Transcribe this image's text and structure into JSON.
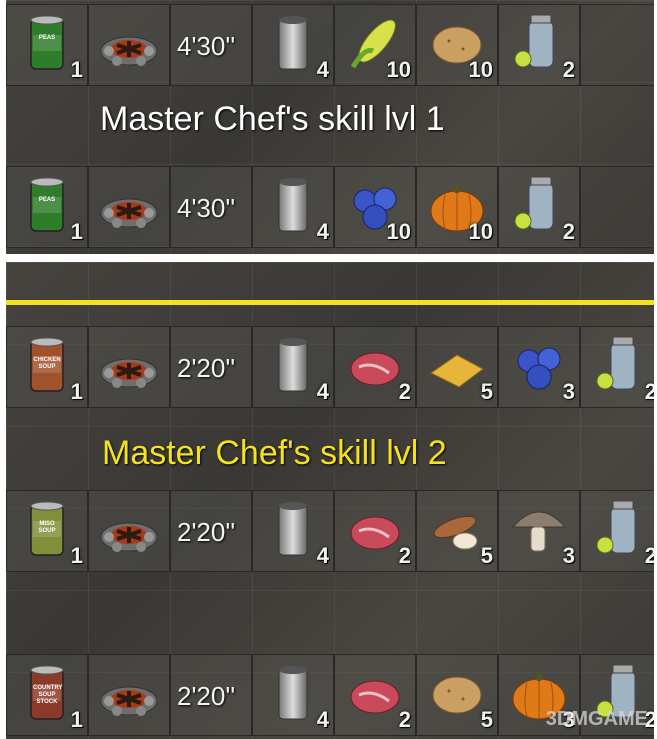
{
  "recipes_lvl1": [
    {
      "slots": [
        {
          "icon": "can-of-peas-icon",
          "qty": "1",
          "label": "PEAS"
        },
        {
          "icon": "campfire-icon"
        },
        {
          "time": "4'30''"
        },
        {
          "icon": "empty-can-icon",
          "qty": "4"
        },
        {
          "icon": "corn-icon",
          "qty": "10"
        },
        {
          "icon": "potato-icon",
          "qty": "10"
        },
        {
          "icon": "water-jar-icon",
          "qty": "2"
        }
      ]
    },
    {
      "slots": [
        {
          "icon": "can-of-peas-icon",
          "qty": "1",
          "label": "PEAS"
        },
        {
          "icon": "campfire-icon"
        },
        {
          "time": "4'30''"
        },
        {
          "icon": "empty-can-icon",
          "qty": "4"
        },
        {
          "icon": "blueberries-icon",
          "qty": "10"
        },
        {
          "icon": "pumpkin-icon",
          "qty": "10"
        },
        {
          "icon": "water-jar-icon",
          "qty": "2"
        }
      ]
    }
  ],
  "skill_lvl1": "Master Chef's skill lvl 1",
  "skill_lvl2": "Master Chef's skill lvl 2",
  "recipes_lvl2": [
    {
      "slots": [
        {
          "icon": "chicken-soup-can-icon",
          "qty": "1",
          "label": "CHICKEN SOUP"
        },
        {
          "icon": "campfire-icon"
        },
        {
          "time": "2'20''"
        },
        {
          "icon": "empty-can-icon",
          "qty": "4"
        },
        {
          "icon": "raw-meat-icon",
          "qty": "2"
        },
        {
          "icon": "corn-meal-icon",
          "qty": "5"
        },
        {
          "icon": "blueberries-icon",
          "qty": "3"
        },
        {
          "icon": "water-jar-icon",
          "qty": "2"
        }
      ]
    },
    {
      "slots": [
        {
          "icon": "miso-soup-can-icon",
          "qty": "1",
          "label": "MISO SOUP"
        },
        {
          "icon": "campfire-icon"
        },
        {
          "time": "2'20''"
        },
        {
          "icon": "empty-can-icon",
          "qty": "4"
        },
        {
          "icon": "raw-meat-icon",
          "qty": "2"
        },
        {
          "icon": "yucca-root-icon",
          "qty": "5"
        },
        {
          "icon": "mushroom-icon",
          "qty": "3"
        },
        {
          "icon": "water-jar-icon",
          "qty": "2"
        }
      ]
    },
    {
      "slots": [
        {
          "icon": "country-soup-can-icon",
          "qty": "1",
          "label": "COUNTRY SOUP STOCK"
        },
        {
          "icon": "campfire-icon"
        },
        {
          "time": "2'20''"
        },
        {
          "icon": "empty-can-icon",
          "qty": "4"
        },
        {
          "icon": "raw-meat-icon",
          "qty": "2"
        },
        {
          "icon": "potato-icon",
          "qty": "5"
        },
        {
          "icon": "pumpkin-icon",
          "qty": "3"
        },
        {
          "icon": "water-jar-icon",
          "qty": "2"
        }
      ]
    }
  ],
  "watermark": "3DMGAME",
  "colors": {
    "highlight": "#f4e21e",
    "panel": "#3c3a37"
  }
}
